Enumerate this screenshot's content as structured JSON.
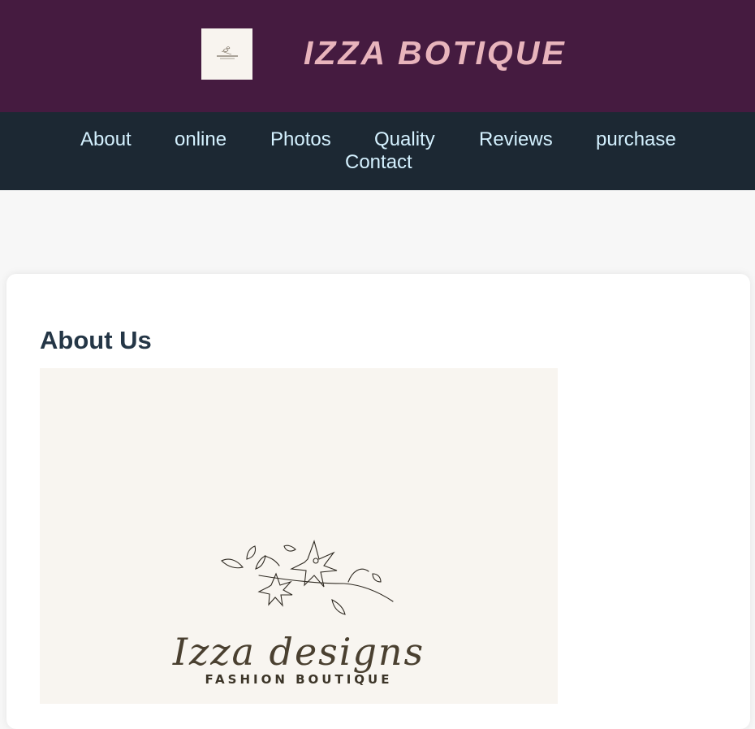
{
  "header": {
    "title": "IZZA BOTIQUE",
    "logo_icon": "boutique-logo-icon"
  },
  "nav": {
    "items": [
      {
        "label": "About"
      },
      {
        "label": "online"
      },
      {
        "label": "Photos"
      },
      {
        "label": "Quality"
      },
      {
        "label": "Reviews"
      },
      {
        "label": "purchase"
      },
      {
        "label": "Contact"
      }
    ]
  },
  "about": {
    "heading": "About Us",
    "image": {
      "brand_script": "Izza designs",
      "tagline": "FASHION BOUTIQUE",
      "icon": "flower-icon"
    }
  },
  "colors": {
    "header_bg": "#451b40",
    "title": "#e8b4bc",
    "nav_bg": "#1c2833",
    "nav_link": "#d4f1ff",
    "heading": "#243646"
  }
}
